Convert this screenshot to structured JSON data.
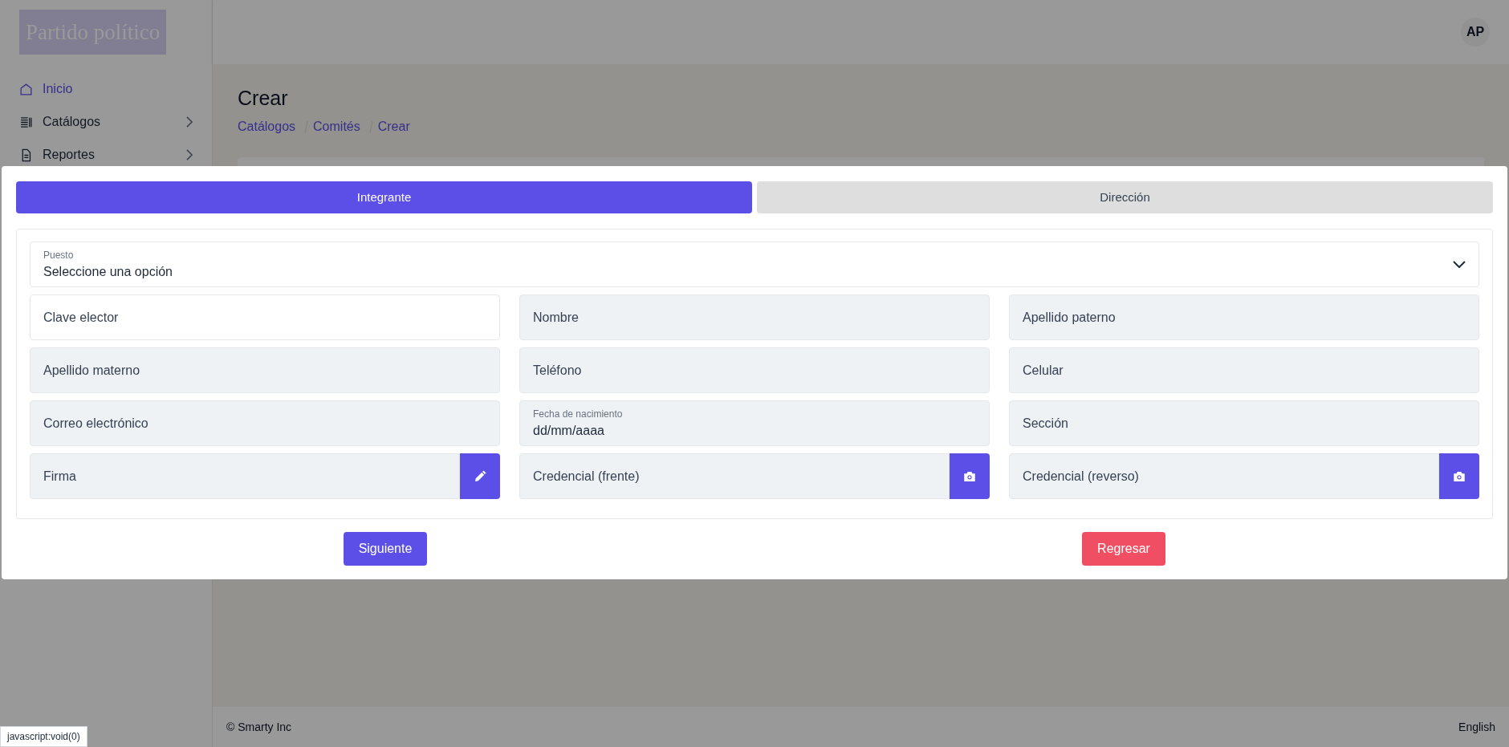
{
  "sidebar": {
    "logo": "Partido político",
    "items": [
      {
        "label": "Inicio",
        "selected": true,
        "has_submenu": false
      },
      {
        "label": "Catálogos",
        "selected": false,
        "has_submenu": true
      },
      {
        "label": "Reportes",
        "selected": false,
        "has_submenu": true
      }
    ]
  },
  "header": {
    "avatar": "AP"
  },
  "page": {
    "title": "Crear",
    "breadcrumb": [
      "Catálogos",
      "Comités",
      "Crear"
    ]
  },
  "footer": {
    "copyright": "© Smarty Inc",
    "language": "English"
  },
  "status_tooltip": "javascript:void(0)",
  "modal": {
    "tabs": [
      {
        "label": "Integrante",
        "selected": true
      },
      {
        "label": "Dirección",
        "selected": false
      }
    ],
    "select": {
      "label": "Puesto",
      "value": "Seleccione una opción"
    },
    "field_rows": [
      [
        {
          "kind": "text",
          "placeholder": "Clave elector",
          "disabled": false
        },
        {
          "kind": "text",
          "placeholder": "Nombre",
          "disabled": true
        },
        {
          "kind": "text",
          "placeholder": "Apellido paterno",
          "disabled": true
        }
      ],
      [
        {
          "kind": "text",
          "placeholder": "Apellido materno",
          "disabled": true
        },
        {
          "kind": "text",
          "placeholder": "Teléfono",
          "disabled": true
        },
        {
          "kind": "text",
          "placeholder": "Celular",
          "disabled": true
        }
      ],
      [
        {
          "kind": "text",
          "placeholder": "Correo electrónico",
          "disabled": true
        },
        {
          "kind": "date",
          "label": "Fecha de nacimiento",
          "value": "dd/mm/aaaa",
          "disabled": true
        },
        {
          "kind": "text",
          "placeholder": "Sección",
          "disabled": true
        }
      ],
      [
        {
          "kind": "action",
          "placeholder": "Firma",
          "disabled": true
        },
        {
          "kind": "action",
          "placeholder": "Credencial (frente)",
          "disabled": true
        },
        {
          "kind": "action",
          "placeholder": "Credencial (reverso)",
          "disabled": true
        }
      ]
    ],
    "buttons": [
      {
        "label": "Siguiente",
        "kind": "primary"
      },
      {
        "label": "Regresar",
        "kind": "danger"
      }
    ]
  }
}
